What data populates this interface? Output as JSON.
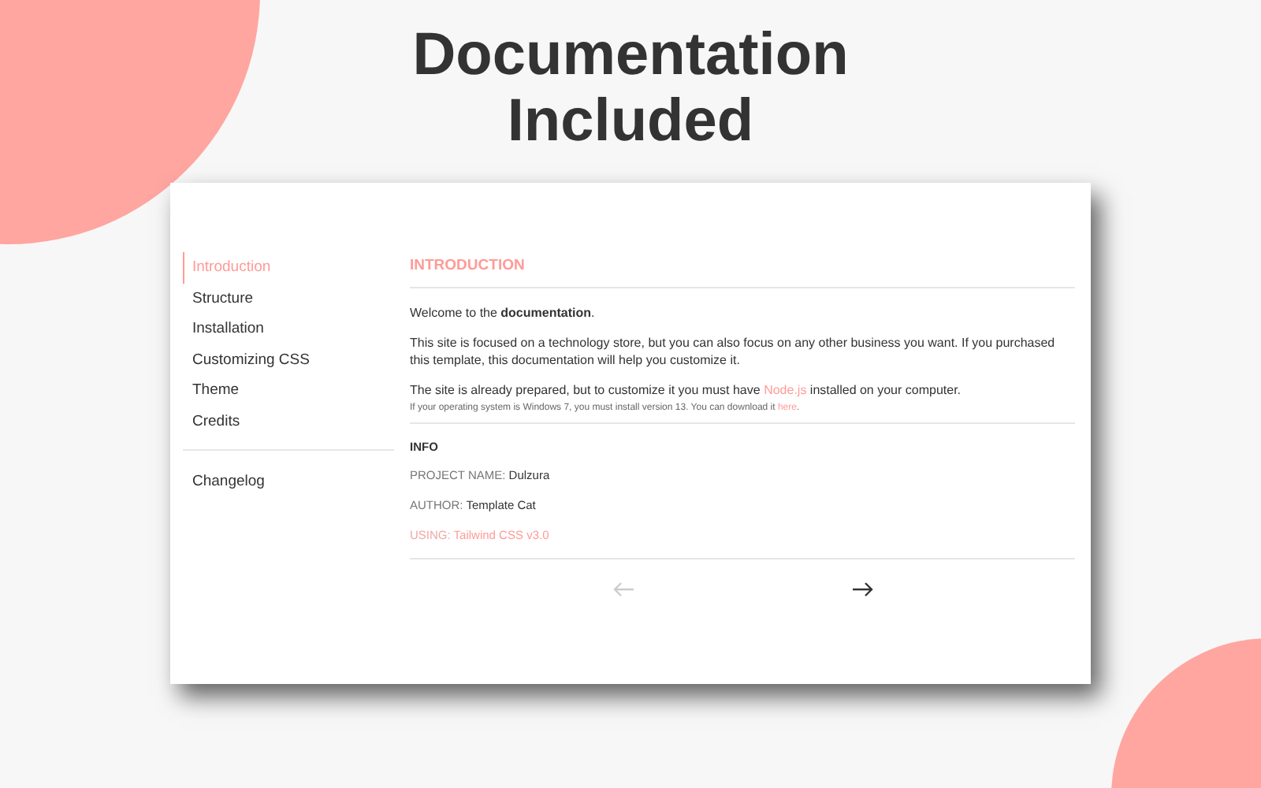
{
  "headline": [
    "Documentation",
    "Included"
  ],
  "sidebar": {
    "items": [
      {
        "label": "Introduction",
        "selected": true
      },
      {
        "label": "Structure",
        "selected": false
      },
      {
        "label": "Installation",
        "selected": false
      },
      {
        "label": "Customizing CSS",
        "selected": false
      },
      {
        "label": "Theme",
        "selected": false
      },
      {
        "label": "Credits",
        "selected": false
      }
    ],
    "extra_items": [
      {
        "label": "Changelog",
        "selected": false
      }
    ]
  },
  "content": {
    "title": "INTRODUCTION",
    "welcome": "Welcome to the **documentation**.",
    "paragraphs": [
      {
        "before": "This site is focused on a technology store, but you can also focus on any other business you want. If you purchased this template, this documentation will help you customize it."
      },
      {
        "before": "The site is already prepared, but to customize it you must have ",
        "link": "Node.js",
        "after": " installed on your computer."
      }
    ],
    "note": {
      "before": "If your operating system is Windows 7, you must install version 13. You can download it ",
      "link": "here",
      "after": "."
    },
    "info": {
      "title": "INFO",
      "rows": [
        {
          "label": "PROJECT NAME:",
          "value": "Dulzura",
          "kind": "text"
        },
        {
          "label": "AUTHOR:",
          "value": "Template Cat",
          "kind": "text"
        },
        {
          "label": "USING:",
          "value": "Tailwind CSS v3.0",
          "kind": "link"
        }
      ]
    },
    "pager": {
      "prev": {
        "disabled": true
      },
      "next": {
        "disabled": false
      }
    }
  }
}
